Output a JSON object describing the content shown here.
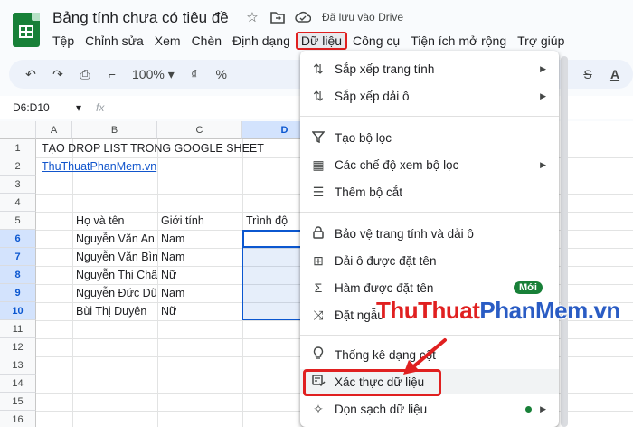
{
  "window": {
    "title": "Bảng tính chưa có tiêu đề",
    "saved_status": "Đã lưu vào Drive"
  },
  "icons": {
    "star": "star-icon",
    "move": "move-to-folder-icon",
    "cloud": "cloud-saved-icon"
  },
  "menubar": [
    "Tệp",
    "Chỉnh sửa",
    "Xem",
    "Chèn",
    "Định dạng",
    "Dữ liệu",
    "Công cụ",
    "Tiện ích mở rộng",
    "Trợ giúp"
  ],
  "toolbar": {
    "zoom": "100%",
    "currency": "₫",
    "percent": "%"
  },
  "namebox": "D6:D10",
  "fx": "fx",
  "columns": [
    "A",
    "B",
    "C",
    "D"
  ],
  "rows": [
    "1",
    "2",
    "3",
    "4",
    "5",
    "6",
    "7",
    "8",
    "9",
    "10",
    "11",
    "12",
    "13",
    "14",
    "15",
    "16"
  ],
  "cells": {
    "a1": "TẠO DROP LIST TRONG GOOGLE SHEET",
    "a2": "ThuThuatPhanMem.vn",
    "b5": "Họ và tên",
    "c5": "Giới tính",
    "d5": "Trình độ",
    "names": [
      "Nguyễn Văn An",
      "Nguyễn Văn Bìn",
      "Nguyễn Thị Châ",
      "Nguyễn Đức Dũ",
      "Bùi Thị Duyên"
    ],
    "genders": [
      "Nam",
      "Nam",
      "Nữ",
      "Nam",
      "Nữ"
    ]
  },
  "dropdown": {
    "items": [
      {
        "label": "Sắp xếp trang tính",
        "icon": "sort-icon",
        "arrow": true
      },
      {
        "label": "Sắp xếp dải ô",
        "icon": "sort-range-icon",
        "arrow": true
      },
      {
        "label": "Tạo bộ lọc",
        "icon": "filter-icon"
      },
      {
        "label": "Các chế độ xem bộ lọc",
        "icon": "filter-views-icon",
        "arrow": true
      },
      {
        "label": "Thêm bộ cắt",
        "icon": "slicer-icon"
      },
      {
        "label": "Bảo vệ trang tính và dải ô",
        "icon": "lock-icon"
      },
      {
        "label": "Dải ô được đặt tên",
        "icon": "named-range-icon"
      },
      {
        "label": "Hàm được đặt tên",
        "icon": "sigma-icon",
        "badge": "Mới"
      },
      {
        "label": "Đặt ngẫu",
        "icon": "shuffle-icon"
      },
      {
        "label": "Thống kê dạng cột",
        "icon": "lightbulb-icon"
      },
      {
        "label": "Xác thực dữ liệu",
        "icon": "data-validation-icon"
      },
      {
        "label": "Dọn sạch dữ liệu",
        "icon": "cleanup-icon",
        "dot": true,
        "arrow": true
      }
    ]
  },
  "watermark": {
    "part1": "ThuThuat",
    "part2": "PhanMem.vn"
  },
  "colors": {
    "accent": "#0b57d0",
    "highlight": "#e02020",
    "brand": "#188038"
  }
}
